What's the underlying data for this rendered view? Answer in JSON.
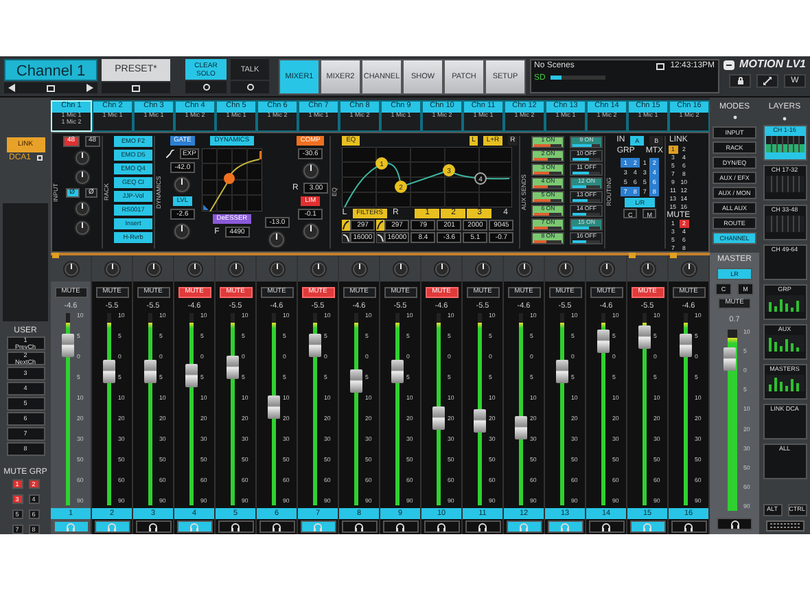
{
  "header": {
    "channel": "Channel 1",
    "preset": "PRESET*",
    "clear_solo": "CLEAR SOLO",
    "talk": "TALK",
    "tabs": [
      {
        "label": "MIXER1",
        "selected": true
      },
      {
        "label": "MIXER2",
        "selected": false
      },
      {
        "label": "CHANNEL",
        "selected": false
      },
      {
        "label": "SHOW",
        "selected": false
      },
      {
        "label": "PATCH",
        "selected": false
      },
      {
        "label": "SETUP",
        "selected": false
      }
    ],
    "scene": "No Scenes",
    "time": "12:43:13PM",
    "storage": {
      "label": "SD",
      "level": 0.2
    },
    "brand": "MOTION LV1",
    "w_button": "W"
  },
  "link": "LINK",
  "dca": "DCA1",
  "channels": [
    {
      "name": "Chn 1",
      "inputs": [
        "1 Mic 1",
        "1 Mic 2"
      ],
      "selected": true
    },
    {
      "name": "Chn 2",
      "inputs": [
        "1 Mic 1"
      ],
      "selected": false
    },
    {
      "name": "Chn 3",
      "inputs": [
        "1 Mic 1"
      ],
      "selected": false
    },
    {
      "name": "Chn 4",
      "inputs": [
        "1 Mic 2"
      ],
      "selected": false
    },
    {
      "name": "Chn 5",
      "inputs": [
        "1 Mic 1"
      ],
      "selected": false
    },
    {
      "name": "Chn 6",
      "inputs": [
        "1 Mic 2"
      ],
      "selected": false
    },
    {
      "name": "Chn 7",
      "inputs": [
        "1 Mic 1"
      ],
      "selected": false
    },
    {
      "name": "Chn 8",
      "inputs": [
        "1 Mic 2"
      ],
      "selected": false
    },
    {
      "name": "Chn 9",
      "inputs": [
        "1 Mic 1"
      ],
      "selected": false
    },
    {
      "name": "Chn 10",
      "inputs": [
        "1 Mic 2"
      ],
      "selected": false
    },
    {
      "name": "Chn 11",
      "inputs": [
        "1 Mic 1"
      ],
      "selected": false
    },
    {
      "name": "Chn 12",
      "inputs": [
        "1 Mic 2"
      ],
      "selected": false
    },
    {
      "name": "Chn 13",
      "inputs": [
        "1 Mic 1"
      ],
      "selected": false
    },
    {
      "name": "Chn 14",
      "inputs": [
        "1 Mic 2"
      ],
      "selected": false
    },
    {
      "name": "Chn 15",
      "inputs": [
        "1 Mic 1"
      ],
      "selected": false
    },
    {
      "name": "Chn 16",
      "inputs": [
        "1 Mic 2"
      ],
      "selected": false
    }
  ],
  "input": {
    "label": "INPUT",
    "phantom": [
      {
        "label": "48",
        "on": true
      },
      {
        "label": "48",
        "on": false
      }
    ],
    "phase": [
      {
        "label": "Ø",
        "on": true
      },
      {
        "label": "Ø",
        "on": false
      }
    ]
  },
  "rack": {
    "label": "RACK",
    "slots": [
      "EMO F2",
      "EMO D5",
      "EMO Q4",
      "GEQ CI",
      "JJP-Vol",
      "RS0017",
      "Insert",
      "H-Rvrb"
    ]
  },
  "dynamics": {
    "label": "DYNAMICS",
    "gate": "GATE",
    "exp": "EXP",
    "gate_value": "-42.0",
    "lvl": "LVL",
    "lvl_value": "-2.6",
    "title": "DYNAMICS",
    "deesser": "DeESSER",
    "f_label": "F",
    "f_value": "4490",
    "deesser_value": "-13.0",
    "comp": "COMP",
    "comp_value": "-30.6",
    "r_label": "R",
    "ratio": "3.00",
    "lim": "LIM",
    "lim_value": "-0.1"
  },
  "eq": {
    "label": "EQ",
    "title": "EQ",
    "sides": [
      {
        "label": "L",
        "selected": true
      },
      {
        "label": "L+R",
        "selected": true
      },
      {
        "label": "R",
        "selected": false
      }
    ],
    "filters": {
      "label": "FILTERS",
      "left": "L",
      "right": "R",
      "columns": [
        {
          "hp": "297",
          "lp": "16000"
        },
        {
          "hp": "297",
          "lp": "16000"
        }
      ]
    },
    "bands": [
      {
        "node": "1",
        "num": "1",
        "freq": "79",
        "gain": "8.4",
        "on": true
      },
      {
        "node": "2",
        "num": "2",
        "freq": "201",
        "gain": "-3.6",
        "on": true
      },
      {
        "node": "3",
        "num": "3",
        "freq": "2000",
        "gain": "5.1",
        "on": true
      },
      {
        "node": "4",
        "num": "4",
        "freq": "9045",
        "gain": "-0.7",
        "on": false
      }
    ]
  },
  "aux_sends": {
    "label": "AUX SENDS",
    "items": [
      {
        "label": "1 ON",
        "on": true,
        "level": 0.6
      },
      {
        "label": "2 ON",
        "on": true,
        "level": 0.5
      },
      {
        "label": "3 ON",
        "on": true,
        "level": 0.55
      },
      {
        "label": "4 ON",
        "on": true,
        "level": 0.5
      },
      {
        "label": "5 ON",
        "on": true,
        "level": 0.6
      },
      {
        "label": "6 ON",
        "on": true,
        "level": 0.55
      },
      {
        "label": "7 ON",
        "on": true,
        "level": 0.5
      },
      {
        "label": "8 ON",
        "on": true,
        "level": 0.45
      },
      {
        "label": "9 ON",
        "on": true,
        "level": 0.7
      },
      {
        "label": "10 OFF",
        "on": false,
        "level": 0.6
      },
      {
        "label": "11 OFF",
        "on": false,
        "level": 0.6
      },
      {
        "label": "12 ON",
        "on": true,
        "level": 0.5
      },
      {
        "label": "13 OFF",
        "on": false,
        "level": 0.55
      },
      {
        "label": "14 OFF",
        "on": false,
        "level": 0.5
      },
      {
        "label": "15 ON",
        "on": true,
        "level": 0.6
      },
      {
        "label": "16 OFF",
        "on": false,
        "level": 0.5
      }
    ]
  },
  "routing": {
    "label": "ROUTING",
    "in": "IN",
    "buses": [
      {
        "label": "A",
        "selected": true
      },
      {
        "label": "B",
        "selected": false
      }
    ],
    "grp_label": "GRP",
    "mtx_label": "MTX",
    "grp": [
      {
        "label": "1",
        "selected": true
      },
      {
        "label": "2",
        "selected": true
      },
      {
        "label": "3",
        "selected": false
      },
      {
        "label": "4",
        "selected": false
      },
      {
        "label": "5",
        "selected": false
      },
      {
        "label": "6",
        "selected": false
      },
      {
        "label": "7",
        "selected": true
      },
      {
        "label": "8",
        "selected": true
      }
    ],
    "mtx": [
      {
        "label": "1",
        "selected": false
      },
      {
        "label": "2",
        "selected": true
      },
      {
        "label": "3",
        "selected": false
      },
      {
        "label": "4",
        "selected": true
      },
      {
        "label": "5",
        "selected": false
      },
      {
        "label": "6",
        "selected": true
      },
      {
        "label": "7",
        "selected": false
      },
      {
        "label": "8",
        "selected": true
      }
    ],
    "lr": {
      "label": "L/R",
      "selected": true
    },
    "c": {
      "label": "C",
      "selected": false
    },
    "m": {
      "label": "M",
      "selected": false
    }
  },
  "link_groups": {
    "label": "LINK",
    "items": [
      {
        "label": "1",
        "selected": true
      },
      {
        "label": "2",
        "selected": false
      },
      {
        "label": "3",
        "selected": false
      },
      {
        "label": "4",
        "selected": false
      },
      {
        "label": "5",
        "selected": false
      },
      {
        "label": "6",
        "selected": false
      },
      {
        "label": "7",
        "selected": false
      },
      {
        "label": "8",
        "selected": false
      },
      {
        "label": "9",
        "selected": false
      },
      {
        "label": "10",
        "selected": false
      },
      {
        "label": "11",
        "selected": false
      },
      {
        "label": "12",
        "selected": false
      },
      {
        "label": "13",
        "selected": false
      },
      {
        "label": "14",
        "selected": false
      },
      {
        "label": "15",
        "selected": false
      },
      {
        "label": "16",
        "selected": false
      }
    ]
  },
  "mute_links": {
    "label": "MUTE",
    "items": [
      {
        "label": "1",
        "selected": false
      },
      {
        "label": "2",
        "selected": true
      },
      {
        "label": "3",
        "selected": false
      },
      {
        "label": "4",
        "selected": false
      },
      {
        "label": "5",
        "selected": false
      },
      {
        "label": "6",
        "selected": false
      },
      {
        "label": "7",
        "selected": false
      },
      {
        "label": "8",
        "selected": false
      }
    ]
  },
  "modes": {
    "label": "MODES",
    "items": [
      {
        "label": "INPUT",
        "selected": false
      },
      {
        "label": "RACK",
        "selected": false
      },
      {
        "label": "DYN/EQ",
        "selected": false
      },
      {
        "label": "AUX / EFX",
        "selected": false
      },
      {
        "label": "AUX / MON",
        "selected": false
      },
      {
        "label": "ALL AUX",
        "selected": false
      },
      {
        "label": "ROUTE",
        "selected": false
      },
      {
        "label": "CHANNEL",
        "selected": true
      }
    ]
  },
  "layers": {
    "label": "LAYERS",
    "items": [
      {
        "label": "CH 1-16",
        "selected": true,
        "kind": "bank"
      },
      {
        "label": "CH 17-32",
        "selected": false,
        "kind": "bank"
      },
      {
        "label": "CH 33-48",
        "selected": false,
        "kind": "bank"
      },
      {
        "label": "CH 49-64",
        "selected": false,
        "kind": "plain"
      },
      {
        "label": "GRP",
        "selected": false,
        "kind": "meters"
      },
      {
        "label": "AUX",
        "selected": false,
        "kind": "meters"
      },
      {
        "label": "MASTERS",
        "selected": false,
        "kind": "meters"
      },
      {
        "label": "LINK DCA",
        "selected": false,
        "kind": "plain"
      },
      {
        "label": "ALL",
        "selected": false,
        "kind": "plain"
      }
    ],
    "keys": [
      "ALT",
      "CTRL"
    ]
  },
  "user": {
    "label": "USER",
    "buttons": [
      {
        "number": "1",
        "label": "PrevCh"
      },
      {
        "number": "2",
        "label": "NextCh"
      },
      {
        "number": "3"
      },
      {
        "number": "4"
      },
      {
        "number": "5"
      },
      {
        "number": "6"
      },
      {
        "number": "7"
      },
      {
        "number": "8"
      }
    ]
  },
  "mute_groups": {
    "label": "MUTE GRP",
    "items": [
      {
        "label": "1",
        "on": true
      },
      {
        "label": "2",
        "on": true
      },
      {
        "label": "3",
        "on": true
      },
      {
        "label": "4",
        "on": false
      },
      {
        "label": "5",
        "on": false
      },
      {
        "label": "6",
        "on": false
      },
      {
        "label": "7",
        "on": false
      },
      {
        "label": "8",
        "on": false
      }
    ]
  },
  "strips": [
    {
      "number": "1",
      "mute": "MUTE",
      "muted": false,
      "value": "-4.6",
      "level": 0.88,
      "meter": {
        "level": 0.95
      },
      "solo": true,
      "linked": true,
      "selected": true,
      "scale": [
        "10",
        "5",
        "0",
        "5",
        "10",
        "20",
        "30",
        "50",
        "60",
        "90"
      ]
    },
    {
      "number": "2",
      "mute": "MUTE",
      "muted": false,
      "value": "-5.5",
      "level": 0.72,
      "meter": {
        "level": 0.95
      },
      "solo": true,
      "linked": false,
      "selected": false,
      "scale": [
        "10",
        "5",
        "0",
        "5",
        "10",
        "20",
        "30",
        "50",
        "60",
        "90"
      ]
    },
    {
      "number": "3",
      "mute": "MUTE",
      "muted": false,
      "value": "-5.5",
      "level": 0.72,
      "meter": {
        "level": 0.95
      },
      "solo": false,
      "linked": false,
      "selected": false,
      "scale": [
        "10",
        "5",
        "0",
        "5",
        "10",
        "20",
        "30",
        "50",
        "60",
        "90"
      ]
    },
    {
      "number": "4",
      "mute": "MUTE",
      "muted": true,
      "value": "-4.6",
      "level": 0.7,
      "meter": {
        "level": 0.95
      },
      "solo": true,
      "linked": false,
      "selected": false,
      "scale": [
        "10",
        "5",
        "0",
        "5",
        "10",
        "20",
        "30",
        "50",
        "60",
        "90"
      ]
    },
    {
      "number": "5",
      "mute": "MUTE",
      "muted": true,
      "value": "-5.5",
      "level": 0.75,
      "meter": {
        "level": 0.95
      },
      "solo": false,
      "linked": false,
      "selected": false,
      "scale": [
        "10",
        "5",
        "0",
        "5",
        "10",
        "20",
        "30",
        "50",
        "60",
        "90"
      ]
    },
    {
      "number": "6",
      "mute": "MUTE",
      "muted": false,
      "value": "-4.6",
      "level": 0.51,
      "meter": {
        "level": 0.95
      },
      "solo": false,
      "linked": false,
      "selected": false,
      "scale": [
        "10",
        "5",
        "0",
        "5",
        "10",
        "20",
        "30",
        "50",
        "60",
        "90"
      ]
    },
    {
      "number": "7",
      "mute": "MUTE",
      "muted": true,
      "value": "-5.5",
      "level": 0.88,
      "meter": {
        "level": 0.95
      },
      "solo": true,
      "linked": false,
      "selected": false,
      "scale": [
        "10",
        "5",
        "0",
        "5",
        "10",
        "20",
        "30",
        "50",
        "60",
        "90"
      ]
    },
    {
      "number": "8",
      "mute": "MUTE",
      "muted": false,
      "value": "-4.6",
      "level": 0.67,
      "meter": {
        "level": 0.95
      },
      "solo": false,
      "linked": false,
      "selected": false,
      "scale": [
        "10",
        "5",
        "0",
        "5",
        "10",
        "20",
        "30",
        "50",
        "60",
        "90"
      ]
    },
    {
      "number": "9",
      "mute": "MUTE",
      "muted": false,
      "value": "-5.5",
      "level": 0.72,
      "meter": {
        "level": 0.95
      },
      "solo": false,
      "linked": false,
      "selected": false,
      "scale": [
        "10",
        "5",
        "0",
        "5",
        "10",
        "20",
        "30",
        "50",
        "60",
        "90"
      ]
    },
    {
      "number": "10",
      "mute": "MUTE",
      "muted": true,
      "value": "-4.6",
      "level": 0.45,
      "meter": {
        "level": 0.95
      },
      "solo": false,
      "linked": false,
      "selected": false,
      "scale": [
        "10",
        "5",
        "0",
        "5",
        "10",
        "20",
        "30",
        "50",
        "60",
        "90"
      ]
    },
    {
      "number": "11",
      "mute": "MUTE",
      "muted": false,
      "value": "-5.5",
      "level": 0.43,
      "meter": {
        "level": 0.95
      },
      "solo": false,
      "linked": false,
      "selected": false,
      "scale": [
        "10",
        "5",
        "0",
        "5",
        "10",
        "20",
        "30",
        "50",
        "60",
        "90"
      ]
    },
    {
      "number": "12",
      "mute": "MUTE",
      "muted": false,
      "value": "-4.6",
      "level": 0.39,
      "meter": {
        "level": 0.95
      },
      "solo": true,
      "linked": false,
      "selected": false,
      "scale": [
        "10",
        "5",
        "0",
        "5",
        "10",
        "20",
        "30",
        "50",
        "60",
        "90"
      ]
    },
    {
      "number": "13",
      "mute": "MUTE",
      "muted": false,
      "value": "-5.5",
      "level": 0.72,
      "meter": {
        "level": 0.95
      },
      "solo": true,
      "linked": false,
      "selected": false,
      "scale": [
        "10",
        "5",
        "0",
        "5",
        "10",
        "20",
        "30",
        "50",
        "60",
        "90"
      ]
    },
    {
      "number": "14",
      "mute": "MUTE",
      "muted": false,
      "value": "-4.6",
      "level": 0.9,
      "meter": {
        "level": 0.95
      },
      "solo": false,
      "linked": false,
      "selected": false,
      "scale": [
        "10",
        "5",
        "0",
        "5",
        "10",
        "20",
        "30",
        "50",
        "60",
        "90"
      ]
    },
    {
      "number": "15",
      "mute": "MUTE",
      "muted": true,
      "value": "-5.5",
      "level": 0.93,
      "meter": {
        "level": 0.95
      },
      "solo": true,
      "linked": true,
      "selected": false,
      "scale": [
        "10",
        "5",
        "0",
        "5",
        "10",
        "20",
        "30",
        "50",
        "60",
        "90"
      ]
    },
    {
      "number": "16",
      "mute": "MUTE",
      "muted": false,
      "value": "-4.6",
      "level": 0.88,
      "meter": {
        "level": 0.95
      },
      "solo": false,
      "linked": true,
      "selected": false,
      "scale": [
        "10",
        "5",
        "0",
        "5",
        "10",
        "20",
        "30",
        "50",
        "60",
        "90"
      ]
    }
  ],
  "master": {
    "label": "MASTER",
    "lr": {
      "label": "LR",
      "selected": true
    },
    "c": "C",
    "m": "M",
    "mute": "MUTE",
    "muted": false,
    "value": "0.7",
    "level": 0.88,
    "meter": {
      "level": 0.95
    },
    "scale": [
      "10",
      "5",
      "0",
      "5",
      "10",
      "20",
      "30",
      "50",
      "60",
      "90"
    ]
  }
}
